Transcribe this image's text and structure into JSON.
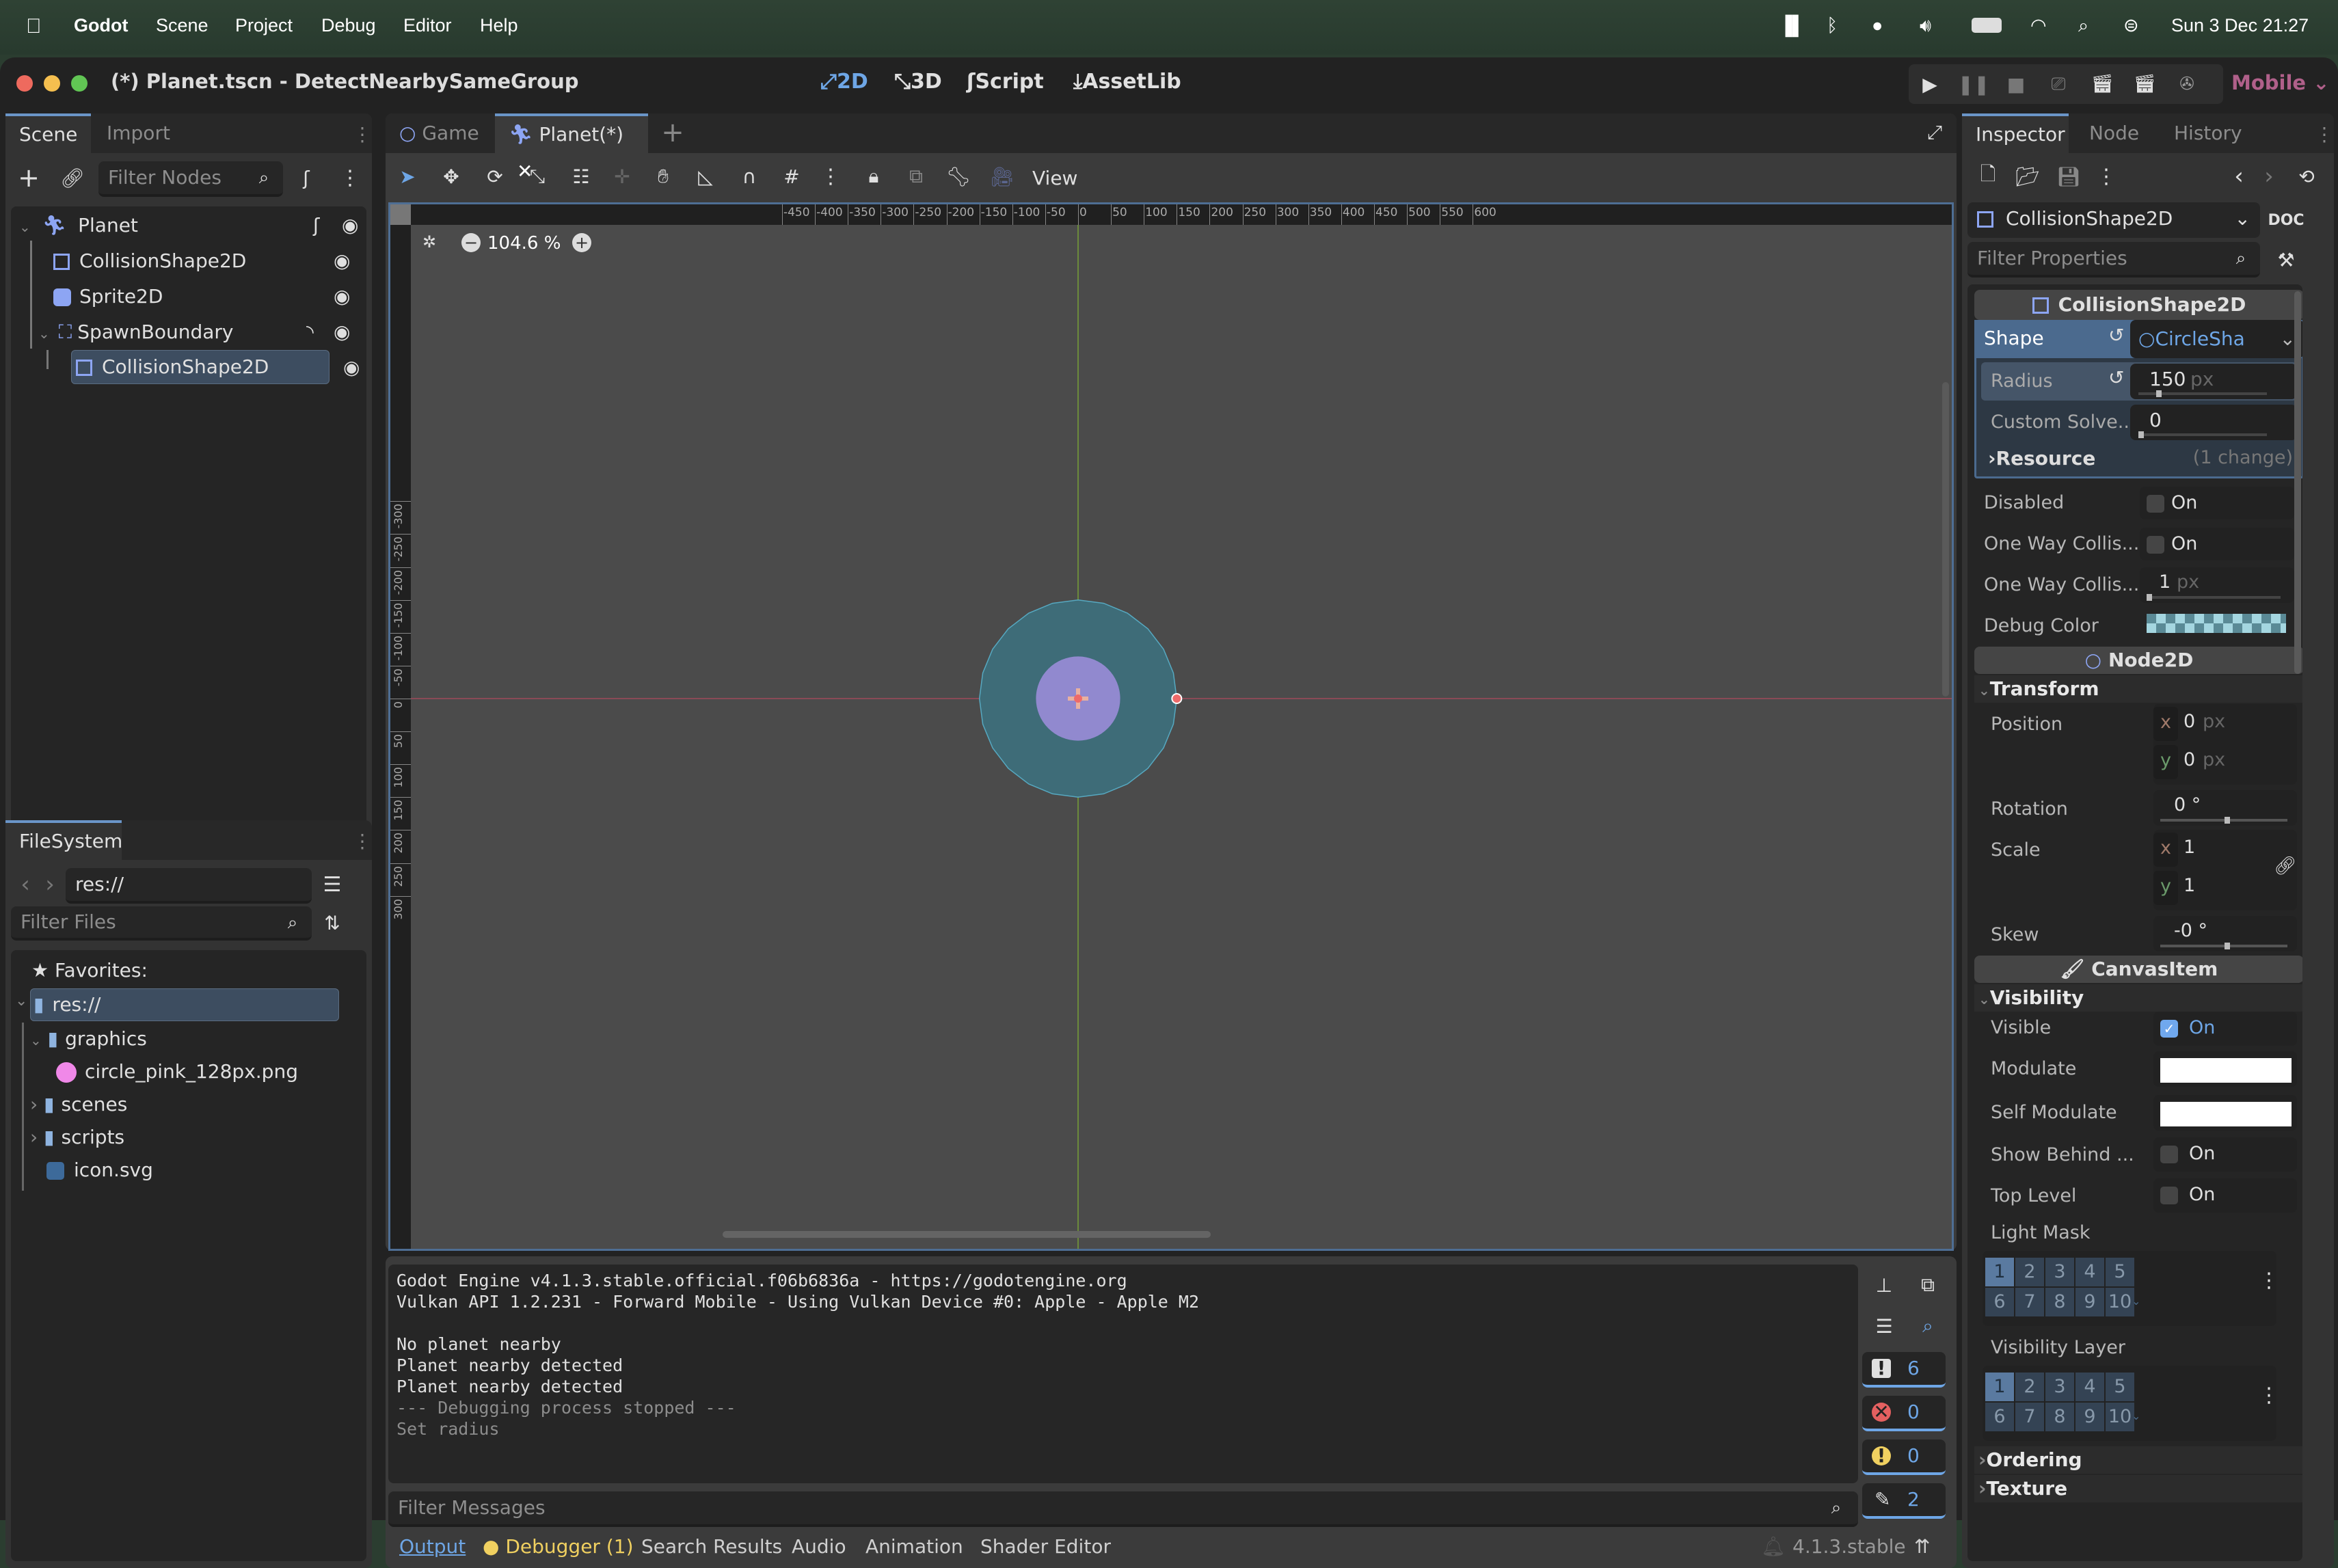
{
  "menubar": {
    "app": "Godot",
    "items": [
      "Scene",
      "Project",
      "Debug",
      "Editor",
      "Help"
    ],
    "datetime": "Sun 3 Dec  21:27",
    "status_icons": [
      "stage-manager-icon",
      "bluetooth-icon",
      "user-icon",
      "volume-icon",
      "battery-icon",
      "wifi-icon",
      "spotlight-search-icon",
      "control-center-icon"
    ]
  },
  "window": {
    "title": "(*) Planet.tscn - DetectNearbySameGroup",
    "workspaces": [
      "2D",
      "3D",
      "Script",
      "AssetLib"
    ],
    "active_workspace": "2D",
    "renderer": "Mobile",
    "run_buttons": [
      "play-icon",
      "pause-icon",
      "stop-icon",
      "remote-debug-icon",
      "play-scene-icon",
      "play-custom-scene-icon",
      "movie-maker-icon"
    ]
  },
  "scene_dock": {
    "tabs": [
      "Scene",
      "Import"
    ],
    "filter_placeholder": "Filter Nodes",
    "nodes": [
      {
        "name": "Planet",
        "type": "root",
        "icon": "character-body-icon",
        "extras": [
          "script-icon"
        ]
      },
      {
        "name": "CollisionShape2D",
        "icon": "collision-shape-icon"
      },
      {
        "name": "Sprite2D",
        "icon": "sprite-icon"
      },
      {
        "name": "SpawnBoundary",
        "icon": "area2d-icon",
        "extras": [
          "signal-icon"
        ]
      },
      {
        "name": "CollisionShape2D",
        "icon": "collision-shape-icon",
        "selected": true
      }
    ]
  },
  "filesystem_dock": {
    "tab": "FileSystem",
    "path": "res://",
    "filter_placeholder": "Filter Files",
    "favorites_label": "Favorites:",
    "items": [
      {
        "name": "res://",
        "type": "folder",
        "selected": true
      },
      {
        "name": "graphics",
        "type": "folder"
      },
      {
        "name": "circle_pink_128px.png",
        "type": "image"
      },
      {
        "name": "scenes",
        "type": "folder"
      },
      {
        "name": "scripts",
        "type": "folder"
      },
      {
        "name": "icon.svg",
        "type": "svg"
      }
    ]
  },
  "editor": {
    "tabs": [
      "Game",
      "Planet(*)"
    ],
    "active_tab": "Planet(*)",
    "view_menu": "View",
    "zoom": "104.6 %",
    "ruler_h": [
      "-450",
      "-400",
      "-350",
      "-300",
      "-250",
      "-200",
      "-150",
      "-100",
      "-50",
      "0",
      "50",
      "100",
      "150",
      "200",
      "250",
      "300",
      "350",
      "400",
      "450",
      "500",
      "550",
      "600"
    ],
    "ruler_v": [
      "-300",
      "-250",
      "-200",
      "-150",
      "-100",
      "-50",
      "0",
      "50",
      "100",
      "150",
      "200",
      "250",
      "300"
    ],
    "shapes": {
      "collision_radius": 150,
      "sprite_diameter": 128,
      "collision_color": "#3e6c78",
      "sprite_color": "#9189cf"
    }
  },
  "output": {
    "lines": [
      {
        "text": "Godot Engine v4.1.3.stable.official.f06b6836a - https://godotengine.org",
        "style": "normal"
      },
      {
        "text": "Vulkan API 1.2.231 - Forward Mobile - Using Vulkan Device #0: Apple - Apple M2",
        "style": "normal"
      },
      {
        "text": "",
        "style": "normal"
      },
      {
        "text": "No planet nearby",
        "style": "normal"
      },
      {
        "text": "Planet nearby detected",
        "style": "normal"
      },
      {
        "text": "Planet nearby detected",
        "style": "normal"
      },
      {
        "text": "--- Debugging process stopped ---",
        "style": "dim"
      },
      {
        "text": "Set radius",
        "style": "dim"
      }
    ],
    "filter_placeholder": "Filter Messages",
    "counts": {
      "messages": "6",
      "errors": "0",
      "warnings": "0",
      "editor": "2"
    },
    "bottom_tabs": [
      "Output",
      "Debugger (1)",
      "Search Results",
      "Audio",
      "Animation",
      "Shader Editor"
    ],
    "version": "4.1.3.stable"
  },
  "inspector": {
    "tabs": [
      "Inspector",
      "Node",
      "History"
    ],
    "object": "CollisionShape2D",
    "filter_placeholder": "Filter Properties",
    "class_header": "CollisionShape2D",
    "shape_label": "Shape",
    "shape_value": "CircleSha",
    "radius_label": "Radius",
    "radius_value": "150",
    "radius_unit": "px",
    "custom_solver_label": "Custom Solve...",
    "custom_solver_value": "0",
    "resource_label": "Resource",
    "resource_changes": "(1 change)",
    "disabled_label": "Disabled",
    "one_way_label": "One Way Collis...",
    "one_way_margin_label": "One Way Collis...",
    "one_way_margin_value": "1",
    "px": "px",
    "on": "On",
    "debug_color_label": "Debug Color",
    "node2d_header": "Node2D",
    "transform_section": "Transform",
    "position_label": "Position",
    "position": {
      "x": "0",
      "y": "0"
    },
    "rotation_label": "Rotation",
    "rotation_value": "0 °",
    "scale_label": "Scale",
    "scale": {
      "x": "1",
      "y": "1"
    },
    "skew_label": "Skew",
    "skew_value": "-0 °",
    "canvasitem_header": "CanvasItem",
    "visibility_section": "Visibility",
    "visible_label": "Visible",
    "visible_checked": true,
    "modulate_label": "Modulate",
    "self_modulate_label": "Self Modulate",
    "show_behind_label": "Show Behind ...",
    "top_level_label": "Top Level",
    "light_mask_label": "Light Mask",
    "visibility_layer_label": "Visibility Layer",
    "layers": [
      "1",
      "2",
      "3",
      "4",
      "5",
      "6",
      "7",
      "8",
      "9",
      "10"
    ],
    "ordering_section": "Ordering",
    "texture_section": "Texture",
    "x": "x",
    "y": "y"
  }
}
